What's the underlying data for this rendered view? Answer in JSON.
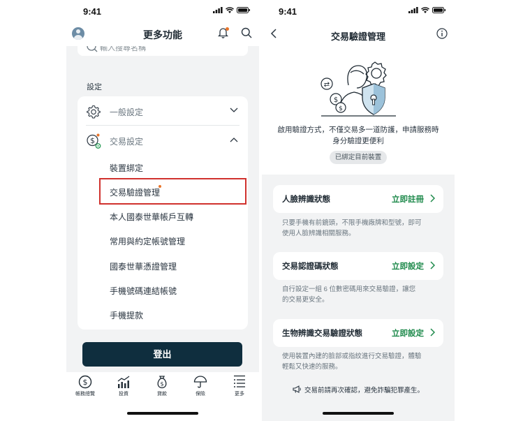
{
  "status_bar": {
    "time": "9:41"
  },
  "more_page": {
    "title": "更多功能",
    "search_placeholder": "輸入搜尋名稱",
    "section_label": "設定",
    "menu": {
      "general": "一般設定",
      "transaction": "交易設定",
      "sub_items": [
        "裝置綁定",
        "交易驗證管理",
        "本人國泰世華帳戶互轉",
        "常用與約定帳號管理",
        "國泰世華憑證管理",
        "手機號碼連結帳號",
        "手機提款"
      ]
    },
    "logout": "登出",
    "tabs": [
      "帳務總覽",
      "投資",
      "貸款",
      "保險",
      "更多"
    ]
  },
  "verify_page": {
    "title": "交易驗證管理",
    "intro_line1": "啟用驗證方式，不僅交易多一道防護，申請服務時",
    "intro_line2": "身分驗證更便利",
    "badge": "已綁定目前裝置",
    "cards": [
      {
        "label": "人臉辨識狀態",
        "action": "立即註冊",
        "desc_line1": "只要手機有前鏡頭，不限手機廠牌和型號，即可",
        "desc_line2": "使用人臉辨識相關服務。"
      },
      {
        "label": "交易認證碼狀態",
        "action": "立即設定",
        "desc_line1": "自行設定一組 6 位數密碼用來交易驗證，讓您",
        "desc_line2": "的交易更安全。"
      },
      {
        "label": "生物辨識交易驗證狀態",
        "action": "立即設定",
        "desc_line1": "使用裝置內建的臉部或指紋進行交易驗證，體驗",
        "desc_line2": "輕鬆又快速的服務。"
      }
    ],
    "warning": "交易前請再次確認，避免詐騙犯罪產生。"
  },
  "colors": {
    "primary_dark": "#0f2e3e",
    "accent_green": "#1f8a4c",
    "notice_orange": "#e8752b",
    "highlight_red": "#d0312d"
  }
}
